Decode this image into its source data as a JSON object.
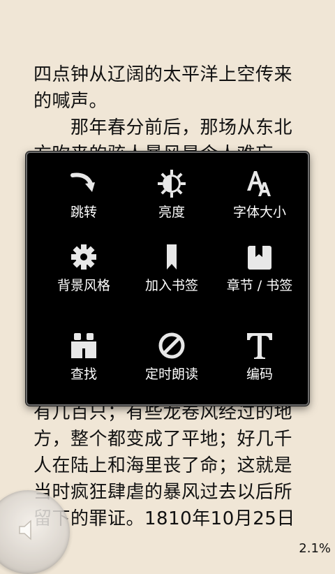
{
  "book": {
    "lines": [
      "四点钟从辽阔的太平洋上空传来",
      "的喊声。",
      "　　那年春分前后，那场从东北",
      "方吹来的骇人暴风是令人难忘",
      "有几百只；有些龙卷风经过的地",
      "方，整个都变成了平地；好几千",
      "人在陆上和海里丧了命；这就是",
      "当时疯狂肆虐的暴风过去以后所",
      "留下的罪证。1810年10月25日"
    ]
  },
  "status": {
    "progress": "2.1%"
  },
  "menu": {
    "items": [
      {
        "label": "跳转",
        "icon": "jump-arrow-icon"
      },
      {
        "label": "亮度",
        "icon": "brightness-icon"
      },
      {
        "label": "字体大小",
        "icon": "font-size-icon"
      },
      {
        "label": "背景风格",
        "icon": "gear-icon"
      },
      {
        "label": "加入书签",
        "icon": "bookmark-icon"
      },
      {
        "label": "章节 / 书签",
        "icon": "book-icon"
      },
      {
        "label": "查找",
        "icon": "binoculars-icon"
      },
      {
        "label": "定时朗读",
        "icon": "timer-icon"
      },
      {
        "label": "编码",
        "icon": "text-encoding-icon"
      }
    ]
  }
}
